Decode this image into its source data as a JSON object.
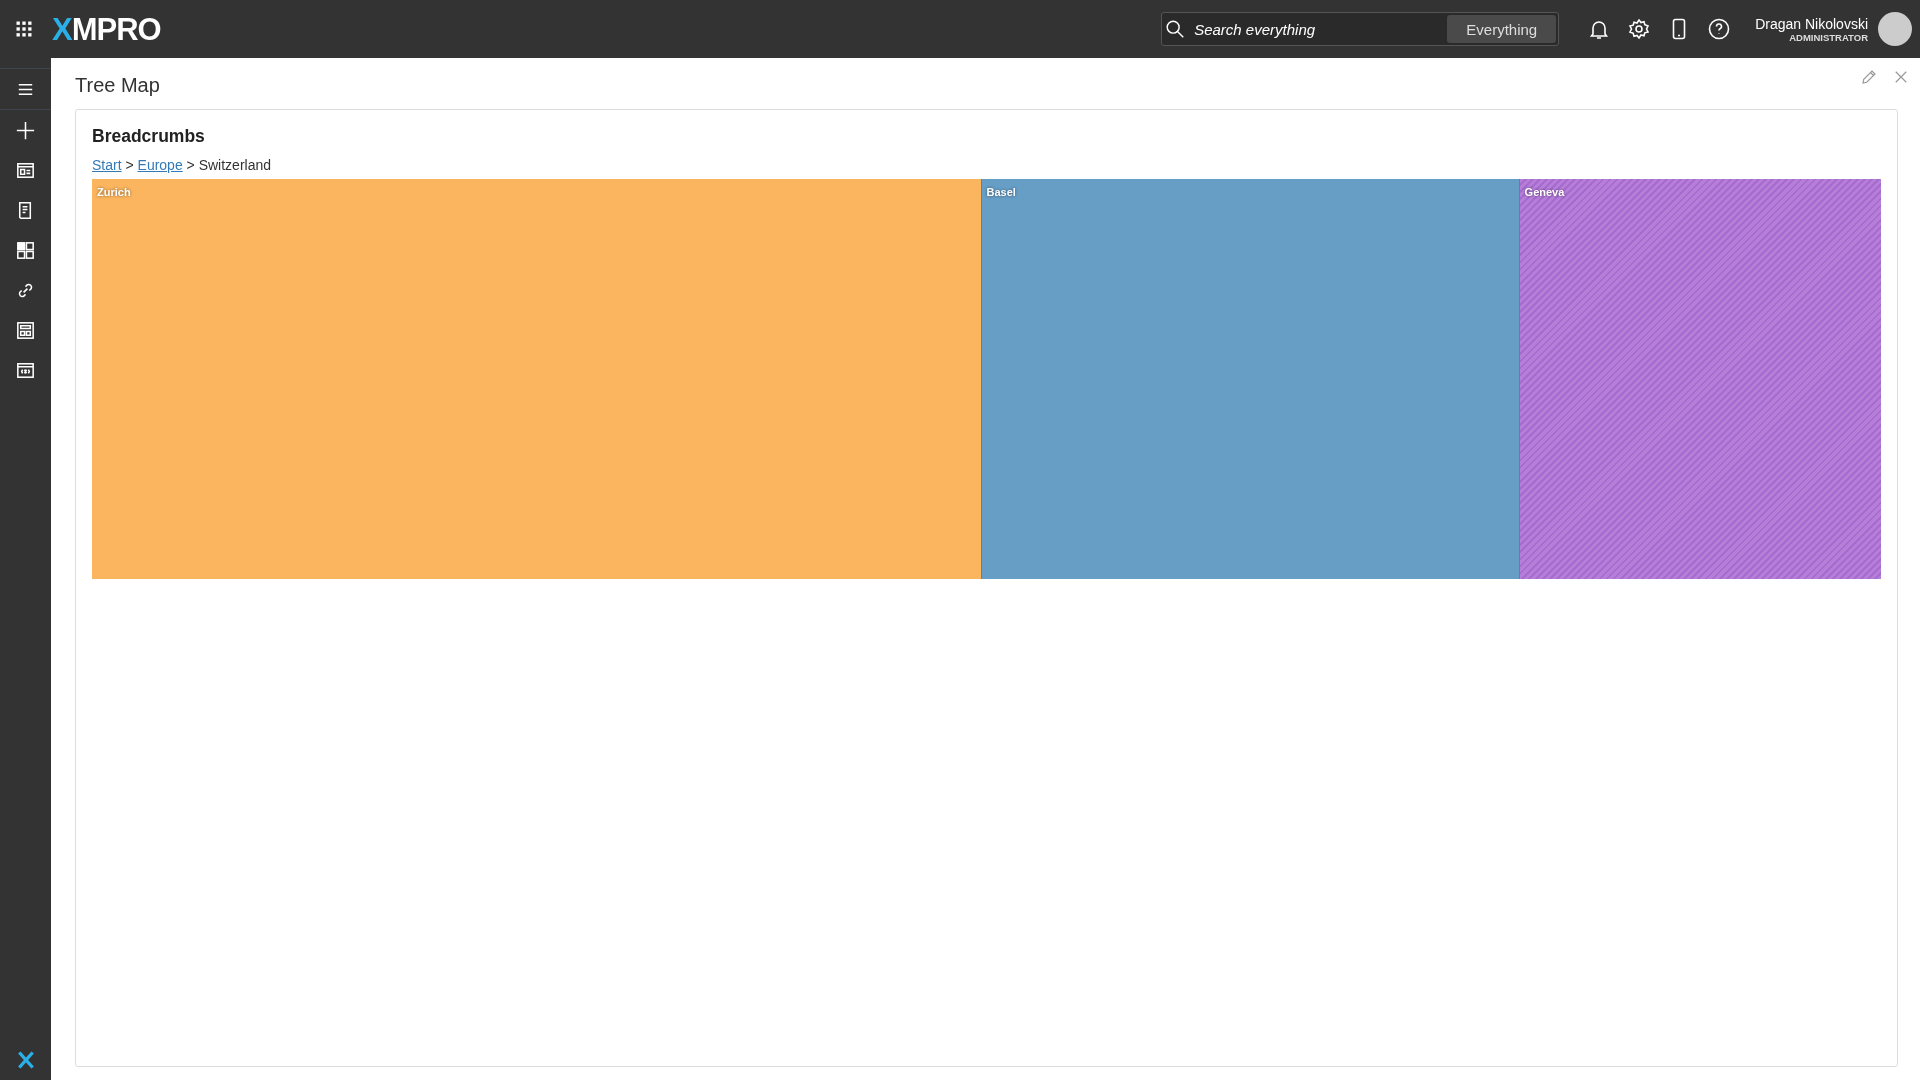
{
  "header": {
    "logo": "XMPRO",
    "search": {
      "placeholder": "Search everything",
      "scope": "Everything"
    },
    "user": {
      "name": "Dragan Nikolovski",
      "role": "ADMINISTRATOR"
    }
  },
  "sidebar": {
    "items": [
      {
        "kind": "menu"
      },
      {
        "kind": "add"
      },
      {
        "kind": "page"
      },
      {
        "kind": "script"
      },
      {
        "kind": "blocks"
      },
      {
        "kind": "link"
      },
      {
        "kind": "calculator"
      },
      {
        "kind": "variable"
      }
    ]
  },
  "page": {
    "title": "Tree Map"
  },
  "card": {
    "title": "Breadcrumbs",
    "breadcrumbs": [
      {
        "label": "Start",
        "link": true
      },
      {
        "label": "Europe",
        "link": true
      },
      {
        "label": "Switzerland",
        "link": false
      }
    ],
    "separator": ">",
    "tiles": [
      {
        "label": "Zurich",
        "color": "#fbb55e",
        "hovered": false
      },
      {
        "label": "Basel",
        "color": "#669ec6",
        "hovered": false
      },
      {
        "label": "Geneva",
        "color": "#b57fd8",
        "hovered": true
      }
    ]
  }
}
